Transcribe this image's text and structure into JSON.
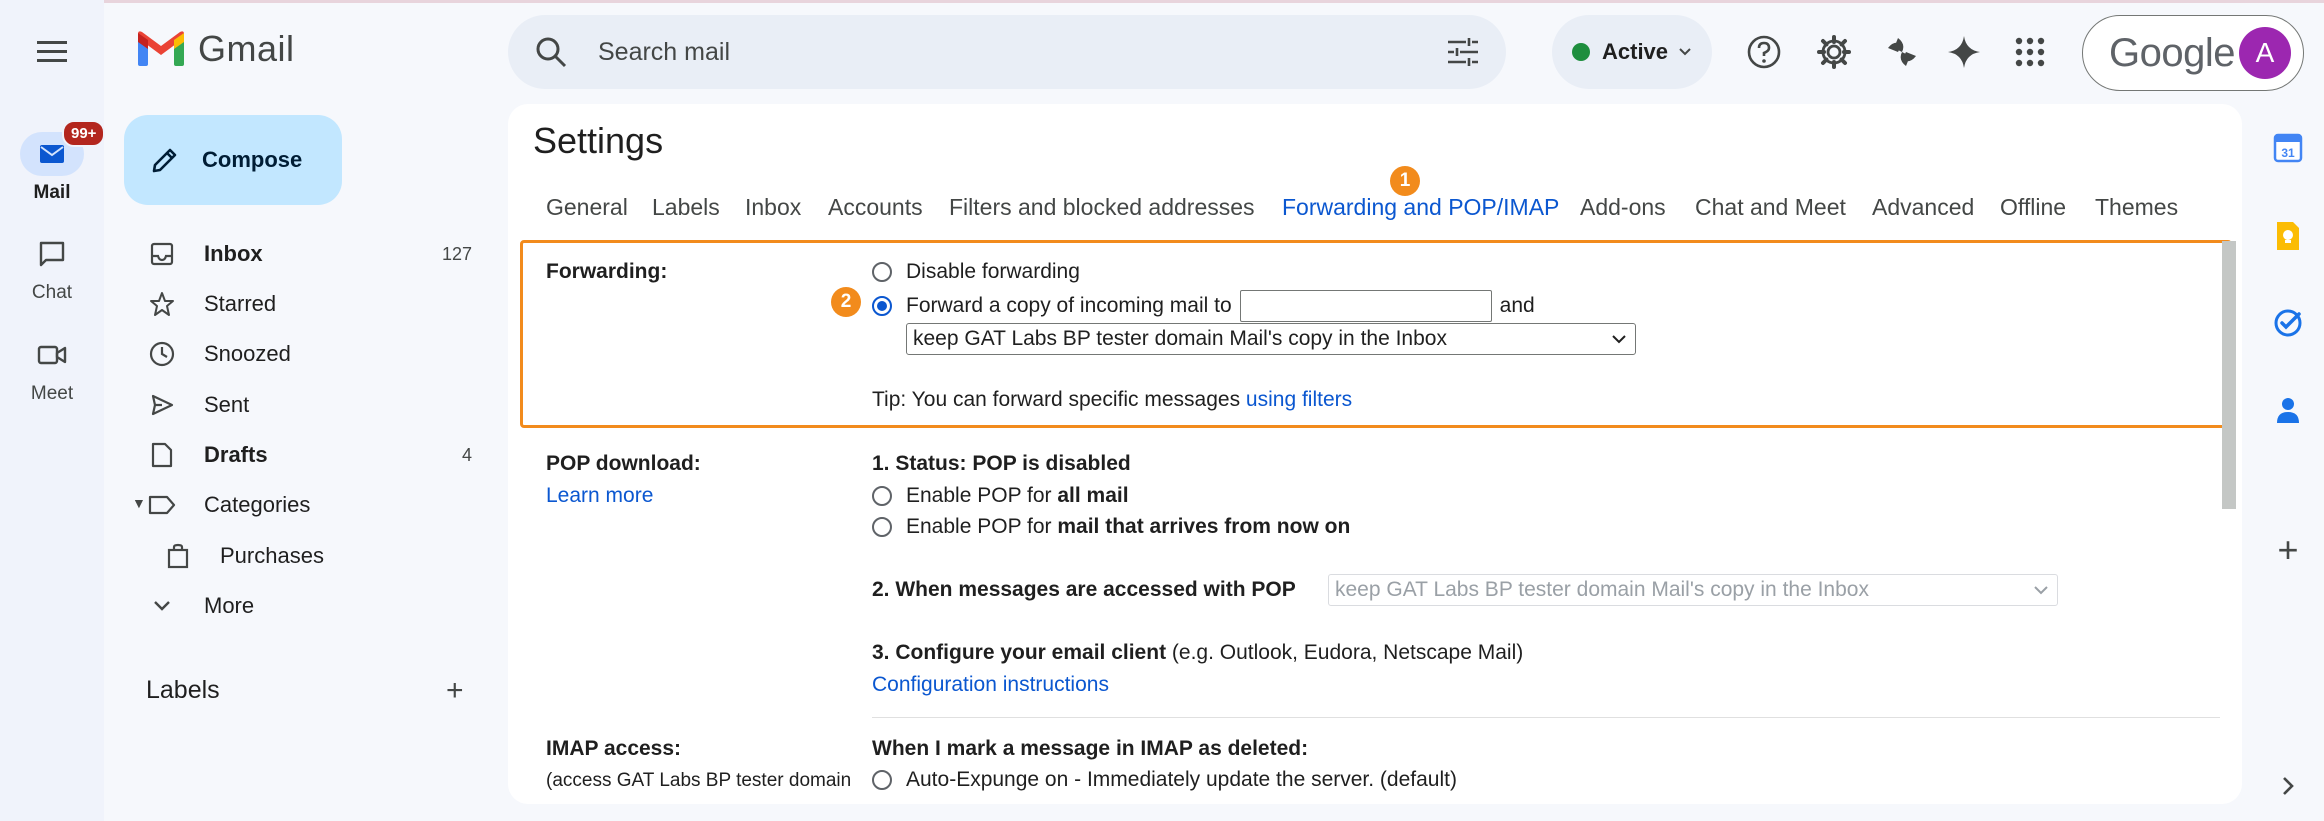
{
  "app": {
    "title": "Gmail",
    "brand_word": "Google"
  },
  "rail": {
    "mail_label": "Mail",
    "mail_badge": "99+",
    "chat_label": "Chat",
    "meet_label": "Meet"
  },
  "compose_label": "Compose",
  "nav": [
    {
      "label": "Inbox",
      "count": "127",
      "bold": true,
      "icon": "inbox-icon"
    },
    {
      "label": "Starred",
      "count": "",
      "icon": "star-icon"
    },
    {
      "label": "Snoozed",
      "count": "",
      "icon": "clock-icon"
    },
    {
      "label": "Sent",
      "count": "",
      "icon": "send-icon"
    },
    {
      "label": "Drafts",
      "count": "4",
      "bold": true,
      "icon": "draft-icon"
    },
    {
      "label": "Categories",
      "count": "",
      "icon": "label-icon"
    },
    {
      "label": "Purchases",
      "count": "",
      "icon": "bag-icon"
    },
    {
      "label": "More",
      "count": "",
      "icon": "chevron-down-icon"
    }
  ],
  "labels_heading": "Labels",
  "search": {
    "placeholder": "Search mail"
  },
  "status": {
    "label": "Active",
    "color": "#1e8e3e"
  },
  "account": {
    "avatar_letter": "A",
    "avatar_color": "#9c27b0"
  },
  "settings": {
    "title": "Settings",
    "tabs": [
      "General",
      "Labels",
      "Inbox",
      "Accounts",
      "Filters and blocked addresses",
      "Forwarding and POP/IMAP",
      "Add-ons",
      "Chat and Meet",
      "Advanced",
      "Offline",
      "Themes"
    ],
    "active_tab": "Forwarding and POP/IMAP",
    "step_markers": [
      "1",
      "2"
    ],
    "forwarding": {
      "label": "Forwarding:",
      "disable": "Disable forwarding",
      "forward_prefix": "Forward a copy of incoming mail to",
      "forward_suffix": "and",
      "forward_address": "",
      "keep_option": "keep GAT Labs BP tester domain Mail's copy in the Inbox",
      "tip_prefix": "Tip: You can forward specific messages ",
      "tip_link": "using filters"
    },
    "pop": {
      "label": "POP download:",
      "learn_more": "Learn more",
      "status": "1. Status: POP is disabled",
      "enable_all_prefix": "Enable POP for ",
      "enable_all_bold": "all mail",
      "enable_now_prefix": "Enable POP for ",
      "enable_now_bold": "mail that arrives from now on",
      "when_accessed": "2. When messages are accessed with POP",
      "when_option": "keep GAT Labs BP tester domain Mail's copy in the Inbox",
      "configure_bold": "3. Configure your email client",
      "configure_rest": " (e.g. Outlook, Eudora, Netscape Mail)",
      "config_link": "Configuration instructions"
    },
    "imap": {
      "label": "IMAP access:",
      "sublabel": "(access GAT Labs BP tester domain",
      "deleted_heading": "When I mark a message in IMAP as deleted:",
      "auto_expunge_on": "Auto-Expunge on - Immediately update the server. (default)"
    }
  },
  "colors": {
    "accent": "#0b57d0",
    "highlight": "#f28b1c",
    "compose_bg": "#c2e7ff"
  }
}
